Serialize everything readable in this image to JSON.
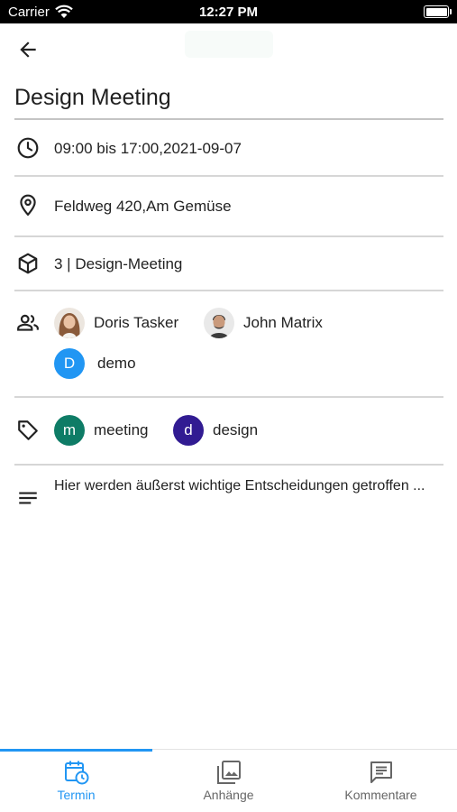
{
  "status_bar": {
    "carrier": "Carrier",
    "time": "12:27 PM"
  },
  "header": {
    "back_icon": "arrow-back-icon",
    "title": "Design Meeting"
  },
  "details": {
    "time": {
      "icon": "clock-icon",
      "text": "09:00 bis 17:00,2021-09-07"
    },
    "location": {
      "icon": "location-pin-icon",
      "text": "Feldweg 420,Am Gemüse"
    },
    "category": {
      "icon": "cube-icon",
      "text": "3 | Design-Meeting"
    },
    "participants": {
      "icon": "people-icon",
      "items": [
        {
          "name": "Doris Tasker",
          "avatar": "photo"
        },
        {
          "name": "John Matrix",
          "avatar": "photo"
        },
        {
          "name": "demo",
          "initial": "D",
          "color": "#2196f3"
        }
      ]
    },
    "tags": {
      "icon": "tag-icon",
      "items": [
        {
          "name": "meeting",
          "initial": "m",
          "color": "#0e7c66"
        },
        {
          "name": "design",
          "initial": "d",
          "color": "#311b92"
        }
      ]
    },
    "description": {
      "icon": "notes-icon",
      "text": "Hier werden äußerst wichtige Entscheidungen getroffen ..."
    }
  },
  "bottom_nav": {
    "active_color": "#2196f3",
    "items": [
      {
        "label": "Termin",
        "icon": "calendar-clock-icon",
        "active": true
      },
      {
        "label": "Anhänge",
        "icon": "image-gallery-icon",
        "active": false
      },
      {
        "label": "Kommentare",
        "icon": "comment-icon",
        "active": false
      }
    ]
  }
}
